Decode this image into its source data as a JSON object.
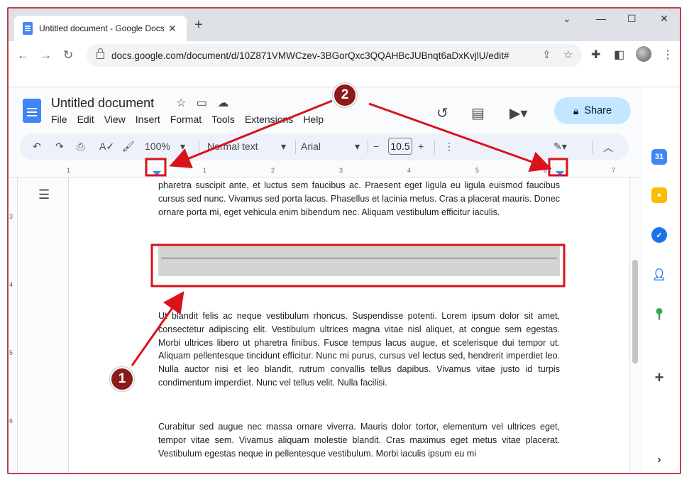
{
  "browser": {
    "tab_title": "Untitled document - Google Docs",
    "new_tab": "+",
    "url": "docs.google.com/document/d/10Z871VMWCzev-3BGorQxc3QQAHBcJUBnqt6aDxKvjlU/edit#",
    "window_controls": [
      "⌄",
      "—",
      "☐",
      "✕"
    ]
  },
  "docs": {
    "title": "Untitled document",
    "menu": [
      "File",
      "Edit",
      "View",
      "Insert",
      "Format",
      "Tools",
      "Extensions",
      "Help"
    ],
    "share_label": "Share",
    "toolbar": {
      "zoom": "100%",
      "style": "Normal text",
      "font": "Arial",
      "font_size": "10.5"
    },
    "ruler_numbers": [
      "1",
      "1",
      "2",
      "3",
      "4",
      "5",
      "6",
      "7"
    ],
    "vruler_numbers": [
      "3",
      "4",
      "5",
      "6"
    ]
  },
  "document": {
    "para1": "pharetra suscipit ante, et luctus sem faucibus ac. Praesent eget ligula eu ligula euismod faucibus cursus sed nunc. Vivamus sed porta lacus. Phasellus et lacinia metus. Cras a placerat mauris. Donec ornare porta mi, eget vehicula enim bibendum nec. Aliquam vestibulum efficitur iaculis.",
    "para2": "Ut blandit felis ac neque vestibulum rhoncus. Suspendisse potenti. Lorem ipsum dolor sit amet, consectetur adipiscing elit. Vestibulum ultrices magna vitae nisl aliquet, at congue sem egestas. Morbi ultrices libero ut pharetra finibus. Fusce tempus lacus augue, et scelerisque dui tempor ut. Aliquam pellentesque tincidunt efficitur. Nunc mi purus, cursus vel lectus sed, hendrerit imperdiet leo. Nulla auctor nisi et leo blandit, rutrum convallis tellus dapibus. Vivamus vitae justo id turpis condimentum imperdiet. Nunc vel tellus velit. Nulla facilisi.",
    "para3": "Curabitur sed augue nec massa ornare viverra. Mauris dolor tortor, elementum vel ultrices eget, tempor vitae sem. Vivamus aliquam molestie blandit. Cras maximus eget metus vitae placerat. Vestibulum egestas neque in pellentesque vestibulum. Morbi iaculis ipsum eu mi"
  },
  "annotations": {
    "badge1": "1",
    "badge2": "2",
    "color": "#d9121b"
  }
}
